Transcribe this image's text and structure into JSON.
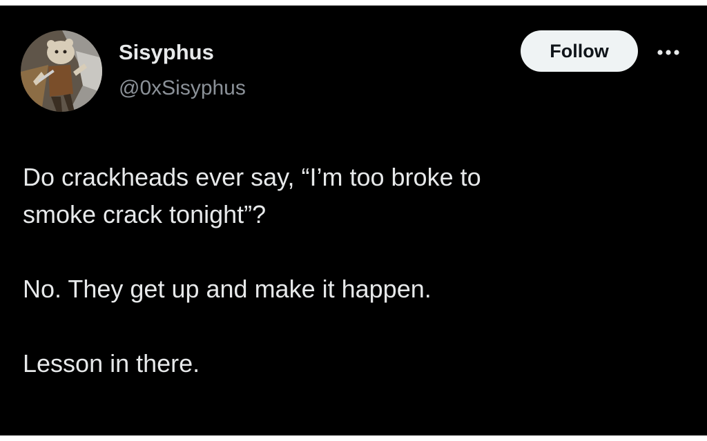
{
  "author": {
    "display_name": "Sisyphus",
    "handle": "@0xSisyphus",
    "avatar_icon": "cartoon-avatar-icon"
  },
  "actions": {
    "follow_label": "Follow",
    "more_icon": "more-options-icon"
  },
  "tweet": {
    "paragraphs": [
      "Do crackheads ever say, “I’m too broke to\nsmoke crack tonight”?",
      "No. They get up and make it happen.",
      "Lesson in there."
    ]
  },
  "colors": {
    "background": "#000000",
    "primary_text": "#e7e9ea",
    "secondary_text": "#8b9198",
    "follow_button_bg": "#eff3f4",
    "follow_button_text": "#0f1419"
  }
}
